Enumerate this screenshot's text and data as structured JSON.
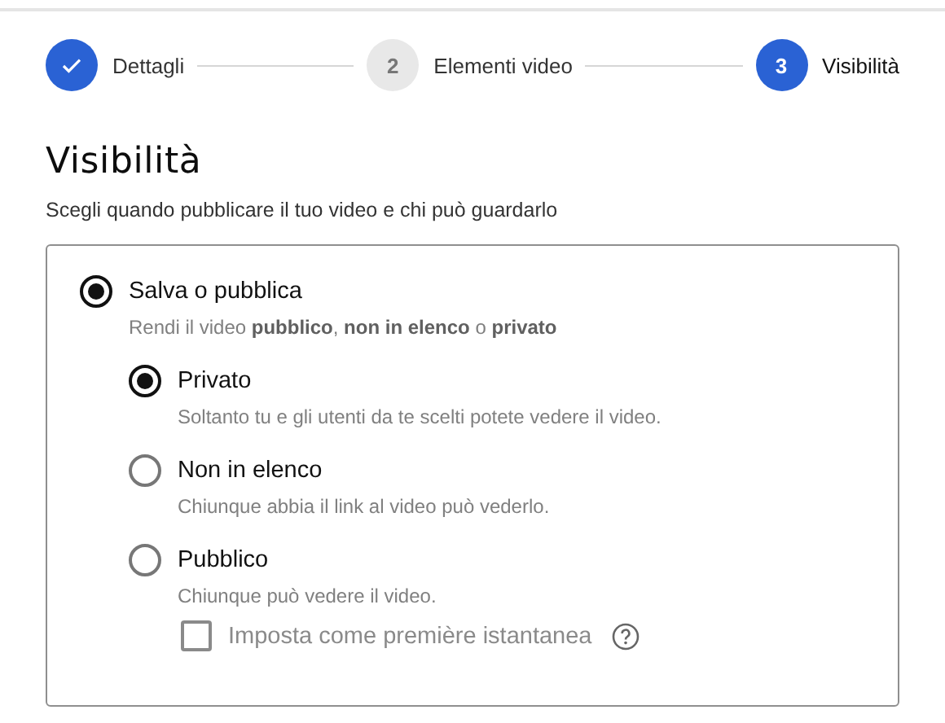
{
  "stepper": [
    {
      "label": "Dettagli",
      "completed": true,
      "active": false
    },
    {
      "number": "2",
      "label": "Elementi video",
      "completed": false,
      "active": false
    },
    {
      "number": "3",
      "label": "Visibilità",
      "completed": false,
      "active": true
    }
  ],
  "heading": "Visibilità",
  "subtitle": "Scegli quando pubblicare il tuo video e chi può guardarlo",
  "main_option": {
    "label": "Salva o pubblica",
    "selected": true,
    "description": "Rendi il video **pubblico**, **non in elenco** o **privato**"
  },
  "options": [
    {
      "label": "Privato",
      "selected": true,
      "description": "Soltanto tu e gli utenti da te scelti potete vedere il video."
    },
    {
      "label": "Non in elenco",
      "selected": false,
      "description": "Chiunque abbia il link al video può vederlo."
    },
    {
      "label": "Pubblico",
      "selected": false,
      "description": "Chiunque può vedere il video."
    }
  ],
  "premiere": {
    "label": "Imposta come première istantanea",
    "checked": false,
    "disabled": true
  }
}
